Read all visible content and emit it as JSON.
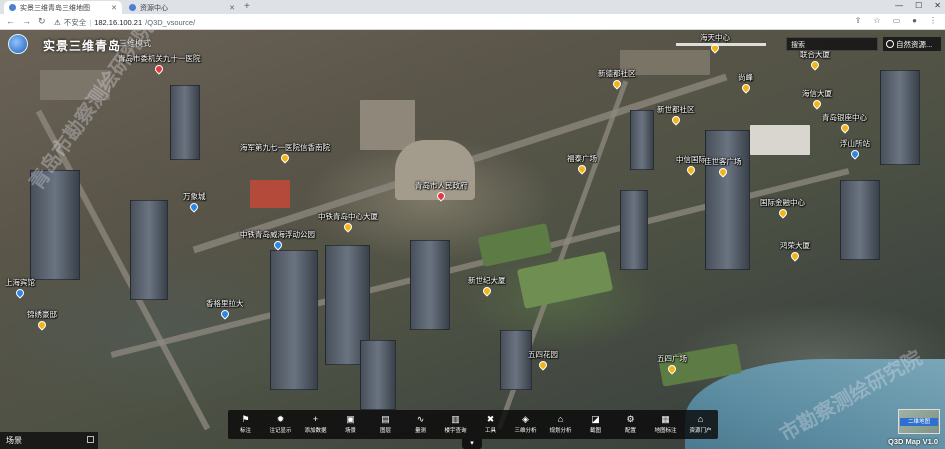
{
  "browser": {
    "tabs": [
      {
        "title": "实景三维青岛三维地图",
        "active": true
      },
      {
        "title": "资源中心",
        "active": false
      }
    ],
    "security_label": "不安全",
    "url_host": "182.16.100.21",
    "url_path": "/Q3D_vsource/"
  },
  "app": {
    "title": "实景三维青岛",
    "mode": "三维模式",
    "search_label": "搜索",
    "user_label": "自然资源..."
  },
  "pois": [
    {
      "label": "青岛市人民政府",
      "color": "red"
    },
    {
      "label": "青岛市委机关九十一医院",
      "color": "red"
    },
    {
      "label": "海军第九七一医院信香南院",
      "color": "yellow"
    },
    {
      "label": "万象城",
      "color": "blue"
    },
    {
      "label": "中铁青岛中心大厦",
      "color": "yellow"
    },
    {
      "label": "中铁青岛威海浮动公园",
      "color": "blue"
    },
    {
      "label": "香格里拉大",
      "color": "blue"
    },
    {
      "label": "上海宾馆",
      "color": "blue"
    },
    {
      "label": "锦绣豪邸",
      "color": "yellow"
    },
    {
      "label": "五四广场",
      "color": "yellow"
    },
    {
      "label": "新世纪大厦",
      "color": "yellow"
    },
    {
      "label": "五四花园",
      "color": "yellow"
    },
    {
      "label": "福泰广场",
      "color": "yellow"
    },
    {
      "label": "新德都社区",
      "color": "yellow"
    },
    {
      "label": "新世都社区",
      "color": "yellow"
    },
    {
      "label": "中信国际",
      "color": "yellow"
    },
    {
      "label": "国际金融中心",
      "color": "yellow"
    },
    {
      "label": "青岛银座中心",
      "color": "yellow"
    },
    {
      "label": "浮山所站",
      "color": "blue"
    },
    {
      "label": "海信大厦",
      "color": "yellow"
    },
    {
      "label": "联合大厦",
      "color": "yellow"
    },
    {
      "label": "尚峰",
      "color": "yellow"
    },
    {
      "label": "佳世客广场",
      "color": "yellow"
    },
    {
      "label": "鸿荣大厦",
      "color": "yellow"
    },
    {
      "label": "海天中心",
      "color": "yellow"
    }
  ],
  "toolbar": [
    {
      "icon": "flag-icon",
      "glyph": "⚑",
      "label": "标注"
    },
    {
      "icon": "bulb-icon",
      "glyph": "✹",
      "label": "注记显示"
    },
    {
      "icon": "plus-icon",
      "glyph": "+",
      "label": "添加数据"
    },
    {
      "icon": "image-icon",
      "glyph": "▣",
      "label": "场景"
    },
    {
      "icon": "layers-icon",
      "glyph": "▤",
      "label": "图层"
    },
    {
      "icon": "measure-icon",
      "glyph": "∿",
      "label": "量测"
    },
    {
      "icon": "building-icon",
      "glyph": "▥",
      "label": "楼宇查询"
    },
    {
      "icon": "tools-icon",
      "glyph": "✖",
      "label": "工具"
    },
    {
      "icon": "analysis-icon",
      "glyph": "◈",
      "label": "三维分析"
    },
    {
      "icon": "plan-icon",
      "glyph": "⌂",
      "label": "规划分析"
    },
    {
      "icon": "screenshot-icon",
      "glyph": "◪",
      "label": "截图"
    },
    {
      "icon": "gear-icon",
      "glyph": "⚙",
      "label": "配置"
    },
    {
      "icon": "map-icon",
      "glyph": "▦",
      "label": "地图标注"
    },
    {
      "icon": "home-icon",
      "glyph": "⌂",
      "label": "资源门户"
    }
  ],
  "scene_panel_label": "场景",
  "minimap_label": "二维地图",
  "version": "Q3D Map V1.0",
  "watermarks": [
    "青岛市勘察测绘研究院",
    "市勘察测绘研究院"
  ]
}
